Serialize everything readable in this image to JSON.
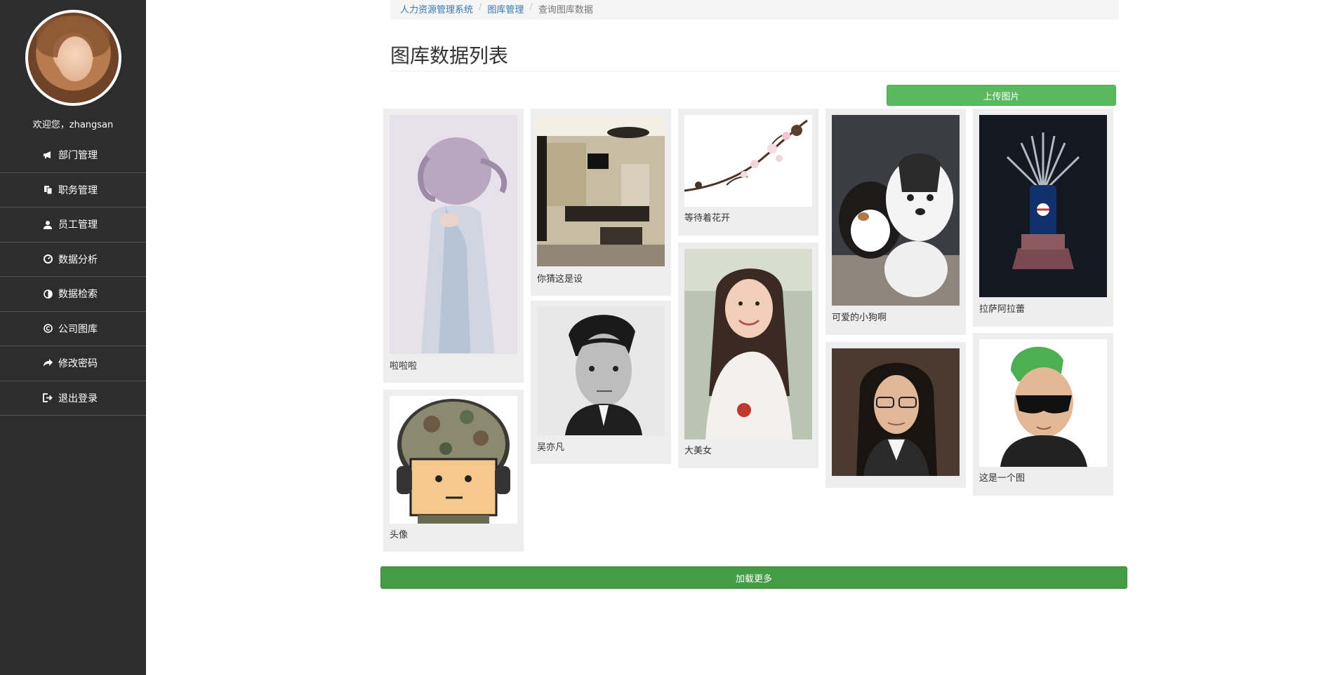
{
  "sidebar": {
    "welcome": "欢迎您，zhangsan",
    "items": [
      {
        "label": "部门管理",
        "icon": "bullhorn-icon"
      },
      {
        "label": "职务管理",
        "icon": "copy-icon"
      },
      {
        "label": "员工管理",
        "icon": "user-icon"
      },
      {
        "label": "数据分析",
        "icon": "dashboard-icon"
      },
      {
        "label": "数据检索",
        "icon": "adjust-icon"
      },
      {
        "label": "公司图库",
        "icon": "copyright-icon"
      },
      {
        "label": "修改密码",
        "icon": "share-arrow-icon"
      },
      {
        "label": "退出登录",
        "icon": "log-out-icon"
      }
    ]
  },
  "breadcrumb": {
    "items": [
      "人力资源管理系统",
      "图库管理",
      "查询图库数据"
    ],
    "separator": "/"
  },
  "page": {
    "title": "图库数据列表",
    "upload_label": "上传图片",
    "load_more_label": "加载更多"
  },
  "gallery": [
    {
      "caption": "啦啦啦",
      "subject": "woman-lilac-hair"
    },
    {
      "caption": "头像",
      "subject": "cartoon-soldier"
    },
    {
      "caption": "你猜这是设",
      "subject": "interior-room"
    },
    {
      "caption": "吴亦凡",
      "subject": "man-portrait"
    },
    {
      "caption": "等待着花开",
      "subject": "blossom-branch"
    },
    {
      "caption": "大美女",
      "subject": "smiling-woman"
    },
    {
      "caption": "可爱的小狗啊",
      "subject": "two-puppies"
    },
    {
      "caption": "",
      "subject": "woman-glasses"
    },
    {
      "caption": "拉萨阿拉蕾",
      "subject": "pepsi-can-throne"
    },
    {
      "caption": "这是一个图",
      "subject": "green-hair-man"
    }
  ],
  "colors": {
    "sidebar_bg": "#2d2d2d",
    "success": "#5cb85c",
    "success_dark": "#449d44",
    "link": "#337ab7",
    "card_bg": "#eeeeee"
  }
}
